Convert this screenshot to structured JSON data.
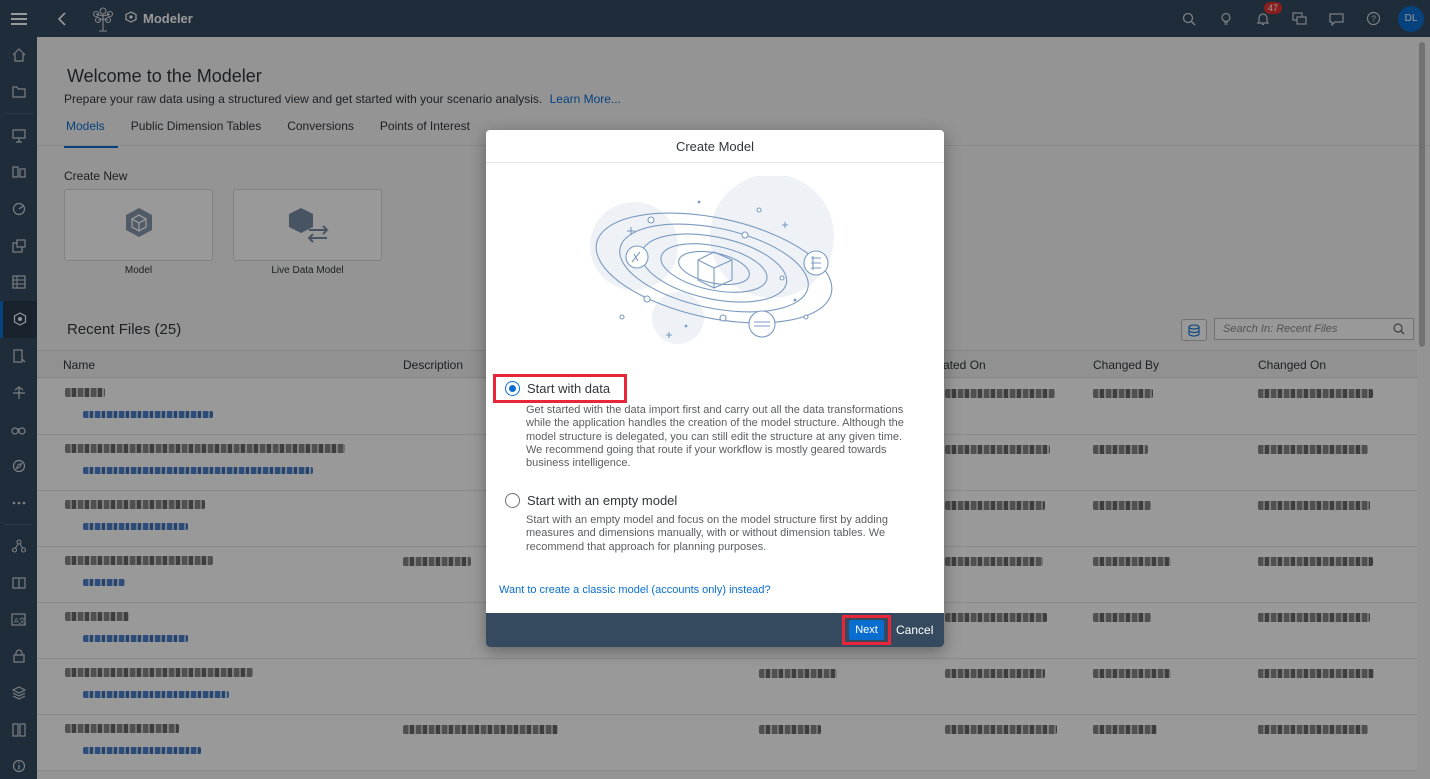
{
  "app": {
    "title": "Modeler",
    "notifications": "47",
    "avatar": "DL"
  },
  "page": {
    "title": "Welcome to the Modeler",
    "subtitle": "Prepare your raw data using a structured view and get started with your scenario analysis.",
    "learn_more": "Learn More...",
    "tabs": [
      "Models",
      "Public Dimension Tables",
      "Conversions",
      "Points of Interest"
    ],
    "create_new": "Create New",
    "tiles": [
      "Model",
      "Live Data Model"
    ],
    "recent_title": "Recent Files (25)",
    "search_placeholder": "Search In: Recent Files",
    "columns": [
      "Name",
      "Description",
      "ated On",
      "Changed By",
      "Changed On"
    ]
  },
  "dialog": {
    "title": "Create Model",
    "option1": {
      "label": "Start with data",
      "desc": "Get started with the data import first and carry out all the data transformations while the application handles the creation of the model structure. Although the model structure is delegated, you can still edit the structure at any given time. We recommend going that route if your workflow is mostly geared towards business intelligence."
    },
    "option2": {
      "label": "Start with an empty model",
      "desc": "Start with an empty model and focus on the model structure first by adding measures and dimensions manually, with or without dimension tables. We recommend that approach for planning purposes."
    },
    "classic_link": "Want to create a classic model (accounts only) instead?",
    "next": "Next",
    "cancel": "Cancel"
  },
  "colors": {
    "shell": "#354a5f",
    "accent": "#0a6ed1",
    "highlight": "#e8263a"
  }
}
